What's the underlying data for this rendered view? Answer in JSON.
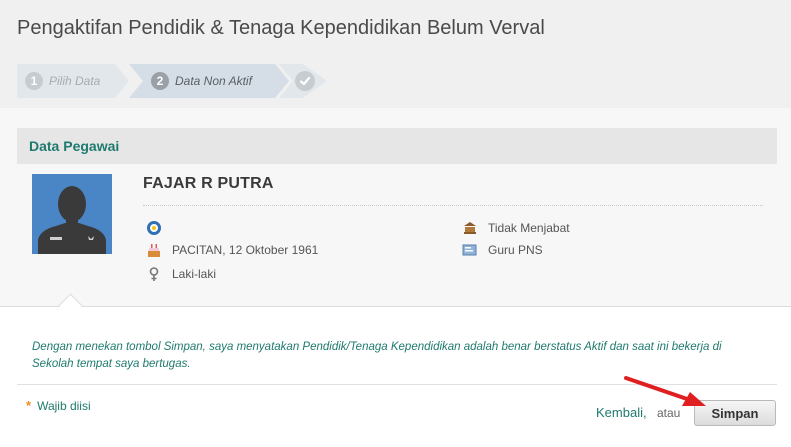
{
  "page": {
    "title": "Pengaktifan Pendidik & Tenaga Kependidikan Belum Verval"
  },
  "wizard": {
    "steps": [
      {
        "number": "1",
        "label": "Pilih Data"
      },
      {
        "number": "2",
        "label": "Data Non Aktif"
      },
      {
        "icon": "check-icon"
      }
    ],
    "active_step": 2
  },
  "section": {
    "title": "Data Pegawai"
  },
  "employee": {
    "name": "FAJAR R PUTRA",
    "birth": "PACITAN, 12 Oktober 1961",
    "gender": "Laki-laki",
    "position": "Tidak Menjabat",
    "employment_type": "Guru PNS"
  },
  "statement": "Dengan menekan tombol Simpan, saya menyatakan Pendidik/Tenaga Kependidikan adalah benar berstatus Aktif dan saat ini bekerja di Sekolah tempat saya bertugas.",
  "footer": {
    "required_star": "*",
    "required_note": "Wajib diisi",
    "back_label": "Kembali,",
    "or_label": "atau",
    "save_label": "Simpan"
  },
  "colors": {
    "accent_teal": "#1f7a6e",
    "required_star": "#f08a24",
    "avatar_bg": "#4a86c5",
    "annotation_arrow": "#e02020"
  }
}
